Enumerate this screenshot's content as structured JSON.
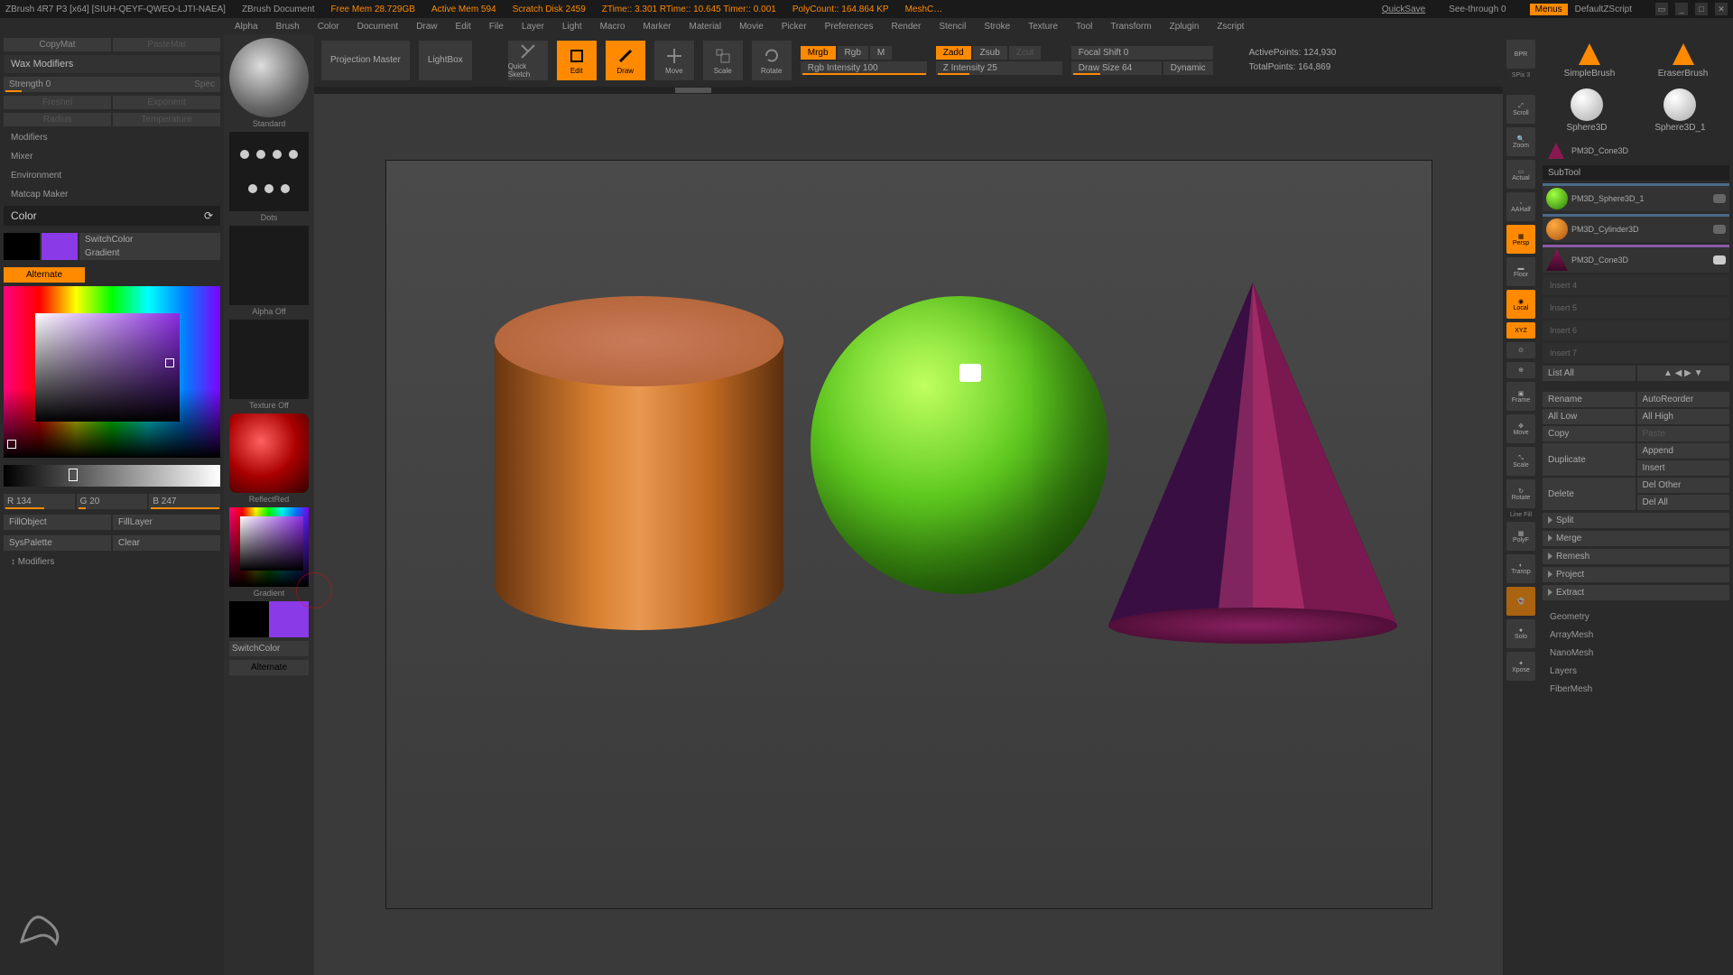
{
  "title": {
    "app": "ZBrush 4R7 P3  [x64] [SIUH-QEYF-QWEO-LJTI-NAEA]",
    "doc": "ZBrush Document",
    "freemem": "Free Mem  28.729GB",
    "activemem": "Active Mem  594",
    "scratch": "Scratch Disk  2459",
    "ztime": "ZTime:: 3.301  RTime:: 10.645  Timer:: 0.001",
    "polycount": "PolyCount:: 164.864 KP",
    "mesh": "MeshC…",
    "quicksave": "QuickSave",
    "seethrough": "See-through   0",
    "menus": "Menus",
    "script": "DefaultZScript"
  },
  "menu": [
    "Alpha",
    "Brush",
    "Color",
    "Document",
    "Draw",
    "Edit",
    "File",
    "Layer",
    "Light",
    "Macro",
    "Marker",
    "Material",
    "Movie",
    "Picker",
    "Preferences",
    "Render",
    "Stencil",
    "Stroke",
    "Texture",
    "Tool",
    "Transform",
    "Zplugin",
    "Zscript"
  ],
  "left": {
    "copymat": "CopyMat",
    "pastemat": "PasteMat",
    "wax": "Wax Modifiers",
    "strength": "Strength 0",
    "spec": "Spec",
    "fresnel": "Fresnel",
    "exponent": "Exponent",
    "radius": "Radius",
    "temperature": "Temperature",
    "modifiers": "Modifiers",
    "mixer": "Mixer",
    "environment": "Environment",
    "matcap": "Matcap Maker",
    "color": "Color",
    "refresh": "⟳",
    "switchcolor": "SwitchColor",
    "gradient": "Gradient",
    "alternate": "Alternate",
    "r": "R 134",
    "g": "G 20",
    "b": "B 247",
    "fillobject": "FillObject",
    "filllayer": "FillLayer",
    "syspalette": "SysPalette",
    "clear": "Clear",
    "modifiers2": "Modifiers"
  },
  "strip": {
    "standard": "Standard",
    "dots": "Dots",
    "alphaoff": "Alpha  Off",
    "textureoff": "Texture  Off",
    "material": "ReflectRed",
    "gradient": "Gradient",
    "switchcolor": "SwitchColor",
    "alternate": "Alternate"
  },
  "toolbar": {
    "projection": "Projection Master",
    "lightbox": "LightBox",
    "quicksketch": "Quick Sketch",
    "edit": "Edit",
    "draw": "Draw",
    "move": "Move",
    "scale": "Scale",
    "rotate": "Rotate",
    "mrgb": "Mrgb",
    "rgb": "Rgb",
    "m": "M",
    "rgbintensity": "Rgb Intensity 100",
    "zadd": "Zadd",
    "zsub": "Zsub",
    "zcut": "Zcut",
    "zintensity": "Z Intensity 25",
    "focalshift": "Focal Shift 0",
    "drawsize": "Draw Size 64",
    "dynamic": "Dynamic",
    "activepoints": "ActivePoints:  124,930",
    "totalpoints": "TotalPoints:  164,869"
  },
  "rightnav": [
    "BPR",
    "SPix 3",
    "Scroll",
    "Zoom",
    "Actual",
    "AAHalf",
    "Persp",
    "Floor",
    "Local",
    "XYZ",
    "⊙",
    "⊕",
    "Frame",
    "Move",
    "Scale",
    "Rotate",
    "Line Fill",
    "PolyF",
    "Transp",
    "Ghost",
    "Solo",
    "Xpose"
  ],
  "right": {
    "brush1": "SimpleBrush",
    "brush2": "EraserBrush",
    "sphere3d": "Sphere3D",
    "sphere3d1": "Sphere3D_1",
    "cone": "PM3D_Cone3D",
    "subtool": "SubTool",
    "st1": "PM3D_Sphere3D_1",
    "st2": "PM3D_Cylinder3D",
    "st3": "PM3D_Cone3D",
    "e4": "Insert  4",
    "e5": "Insert  5",
    "e6": "Insert  6",
    "e7": "Insert  7",
    "listall": "List All",
    "rename": "Rename",
    "autoreorder": "AutoReorder",
    "alllow": "All Low",
    "allhigh": "All High",
    "copy": "Copy",
    "paste": "Paste",
    "duplicate": "Duplicate",
    "append": "Append",
    "insert": "Insert",
    "delete": "Delete",
    "delother": "Del Other",
    "delall": "Del All",
    "split": "Split",
    "merge": "Merge",
    "remesh": "Remesh",
    "project": "Project",
    "extract": "Extract",
    "geometry": "Geometry",
    "arraymesh": "ArrayMesh",
    "nanomesh": "NanoMesh",
    "layers": "Layers",
    "fibermesh": "FiberMesh"
  }
}
